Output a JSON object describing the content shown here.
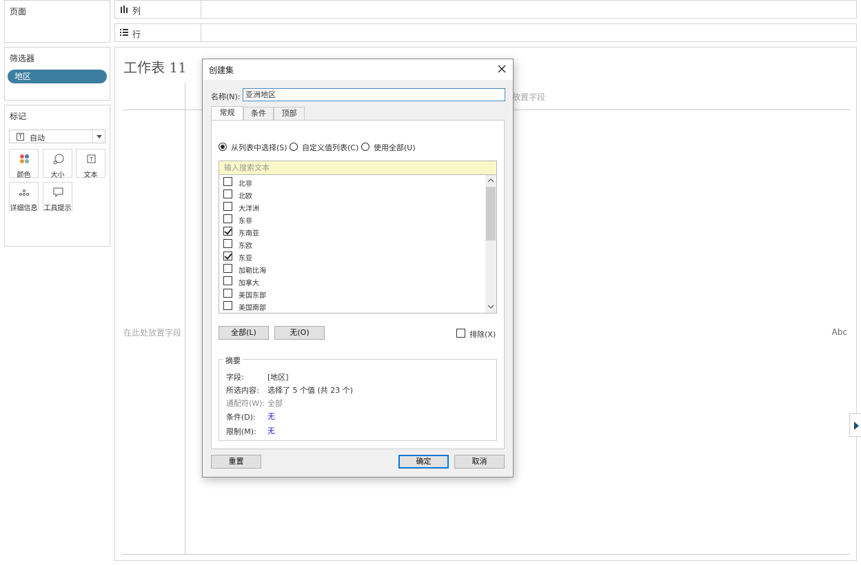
{
  "left_panel": {
    "pages_title": "页面",
    "filters_title": "筛选器",
    "filter_pill": "地区",
    "marks_title": "标记",
    "marks_type": "自动",
    "mark_buttons": {
      "color": "颜色",
      "size": "大小",
      "text": "文本",
      "detail": "详细信息",
      "tooltip": "工具提示"
    }
  },
  "shelves": {
    "columns": "列",
    "rows": "行"
  },
  "worksheet": {
    "title": "工作表 11",
    "drop_field_top": "放置字段",
    "drop_field_left": "在此处放置字段",
    "abc": "Abc"
  },
  "dialog": {
    "title": "创建集",
    "name_label": "名称(N):",
    "name_value": "亚洲地区",
    "tabs": [
      "常规",
      "条件",
      "顶部"
    ],
    "radio_options": [
      {
        "label": "从列表中选择(S)",
        "selected": true
      },
      {
        "label": "自定义值列表(C)",
        "selected": false
      },
      {
        "label": "使用全部(U)",
        "selected": false
      }
    ],
    "search_placeholder": "输入搜索文本",
    "list_items": [
      {
        "label": "北非",
        "checked": false
      },
      {
        "label": "北欧",
        "checked": false
      },
      {
        "label": "大洋洲",
        "checked": false
      },
      {
        "label": "东非",
        "checked": false
      },
      {
        "label": "东南亚",
        "checked": true
      },
      {
        "label": "东欧",
        "checked": false
      },
      {
        "label": "东亚",
        "checked": true
      },
      {
        "label": "加勒比海",
        "checked": false
      },
      {
        "label": "加拿大",
        "checked": false
      },
      {
        "label": "美国东部",
        "checked": false
      },
      {
        "label": "美国南部",
        "checked": false
      }
    ],
    "btn_all": "全部(L)",
    "btn_none": "无(O)",
    "exclude_label": "排除(X)",
    "summary": {
      "legend": "摘要",
      "field_key": "字段:",
      "field_val": "[地区]",
      "selection_key": "所选内容:",
      "selection_val": "选择了 5 个值 (共 23 个)",
      "wildcard_key": "通配符(W):",
      "wildcard_val": "全部",
      "condition_key": "条件(D):",
      "condition_val": "无",
      "limit_key": "限制(M):",
      "limit_val": "无"
    },
    "btn_reset": "重置",
    "btn_ok": "确定",
    "btn_cancel": "取消"
  },
  "colors": {
    "pill": "#3b7ea1",
    "search_bg": "#fbf8c8",
    "accent_blue": "#0078d7",
    "link_blue": "#1a1ad8"
  }
}
